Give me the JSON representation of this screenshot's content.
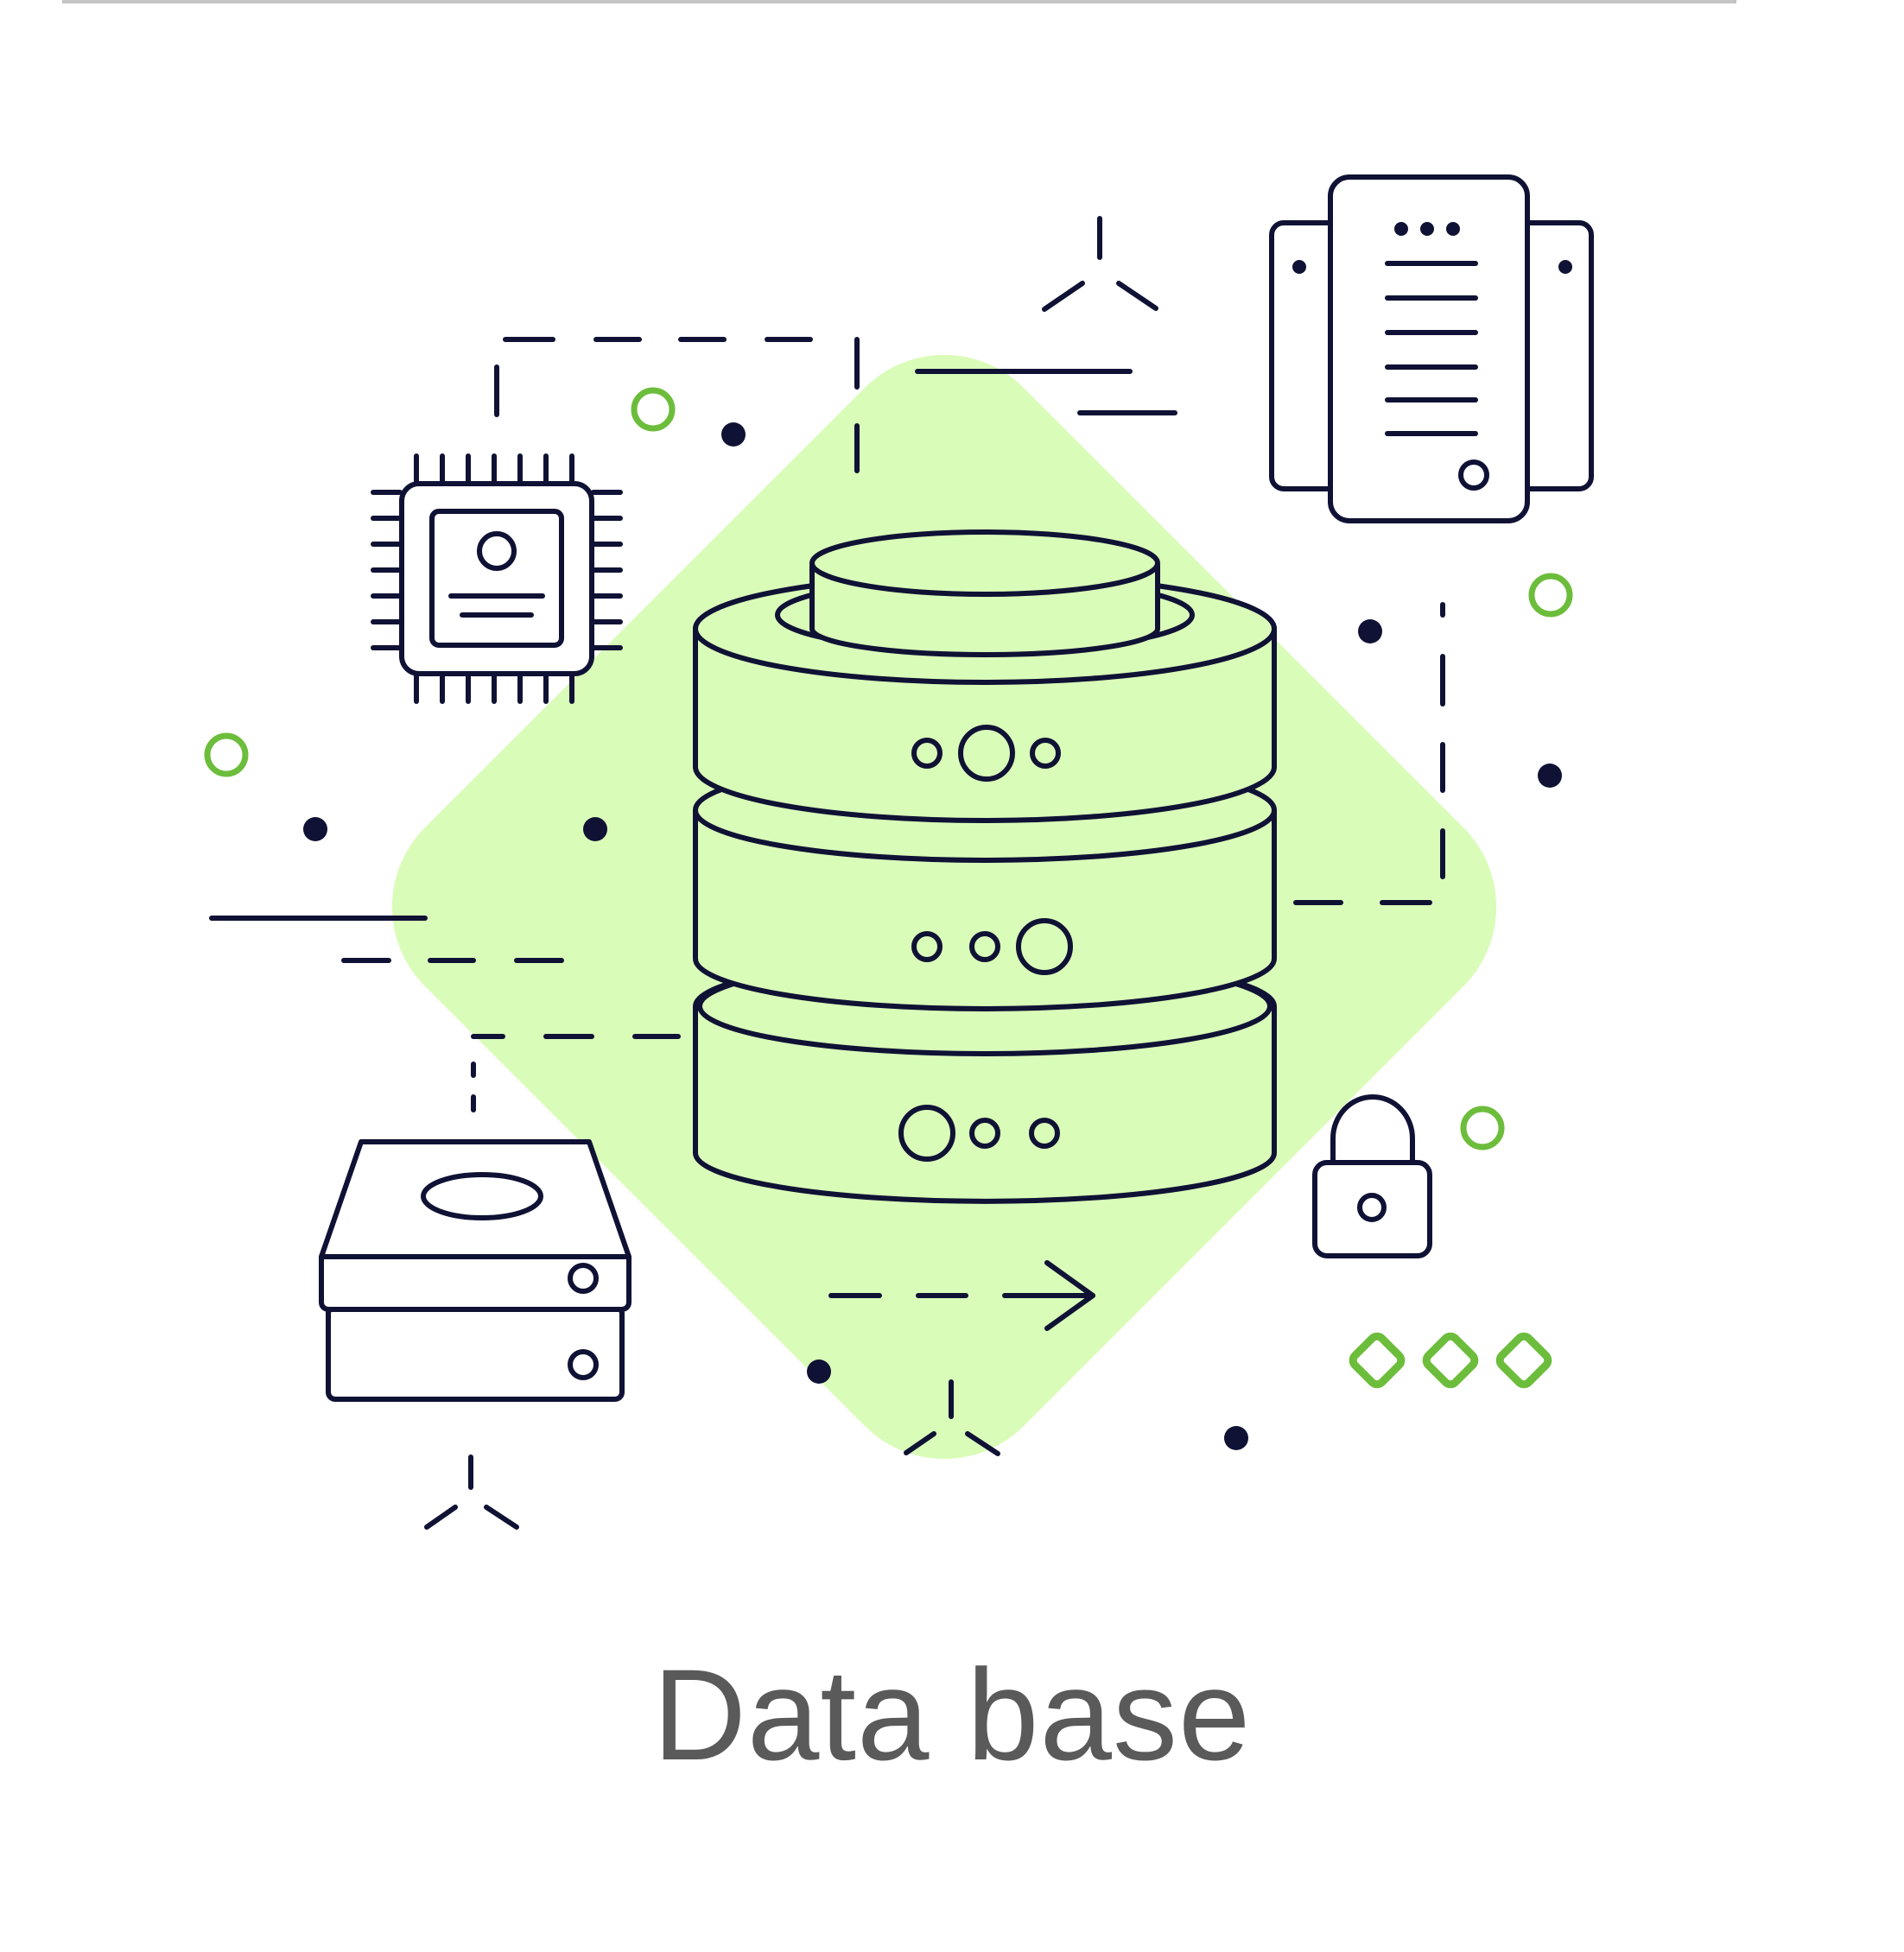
{
  "caption": "Data base",
  "colors": {
    "ink": "#0f1234",
    "accent_fill": "#dafcb9",
    "accent_green": "#6cbd3b",
    "caption_gray": "#5a5a5a",
    "top_rule": "#c4c4c4",
    "background": "#ffffff"
  },
  "icons": [
    "database-stack-icon",
    "cpu-chip-icon",
    "server-tower-icon",
    "hard-drive-stack-icon",
    "padlock-icon",
    "arrow-right-icon"
  ]
}
